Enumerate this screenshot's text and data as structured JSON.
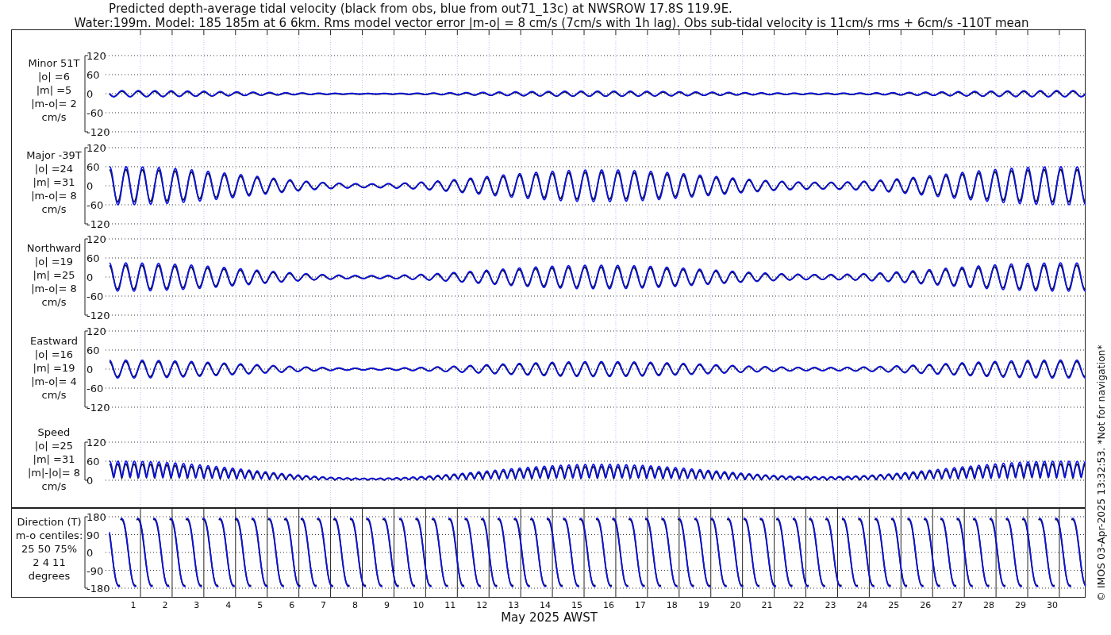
{
  "title_lines": [
    "Predicted depth-average tidal velocity (black from obs, blue from out71_13c) at NWSROW 17.8S 119.9E.",
    "Water:199m. Model: 185 185m at 6 6km. Rms model vector error |m-o| = 8 cm/s (7cm/s with 1h lag). Obs sub-tidal velocity is 11cm/s rms + 6cm/s -110T mean"
  ],
  "panels": [
    {
      "kind": "minor",
      "label_lines": [
        "Minor 51T",
        "|o| =6",
        "|m| =5",
        "|m-o|= 2",
        "cm/s"
      ],
      "yticks": [
        "120",
        "60",
        "0",
        "-60",
        "-120"
      ]
    },
    {
      "kind": "major",
      "label_lines": [
        "Major -39T",
        "|o| =24",
        "|m| =31",
        "|m-o|= 8",
        "cm/s"
      ],
      "yticks": [
        "120",
        "60",
        "0",
        "-60",
        "-120"
      ]
    },
    {
      "kind": "north",
      "label_lines": [
        "Northward",
        "|o| =19",
        "|m| =25",
        "|m-o|= 8",
        "cm/s"
      ],
      "yticks": [
        "120",
        "60",
        "0",
        "-60",
        "-120"
      ]
    },
    {
      "kind": "east",
      "label_lines": [
        "Eastward",
        "|o| =16",
        "|m| =19",
        "|m-o|= 4",
        "cm/s"
      ],
      "yticks": [
        "120",
        "60",
        "0",
        "-60",
        "-120"
      ]
    },
    {
      "kind": "speed",
      "label_lines": [
        "Speed",
        "|o| =25",
        "|m| =31",
        "|m|-|o|= 8",
        "cm/s"
      ],
      "yticks": [
        "120",
        "60",
        "0"
      ]
    },
    {
      "kind": "direction",
      "label_lines": [
        "Direction (T)",
        "m-o centiles:",
        "25 50 75%",
        "2 4 11",
        "degrees"
      ],
      "yticks": [
        "180",
        "90",
        "0",
        "-90",
        "-180"
      ]
    }
  ],
  "xaxis": {
    "day_labels": [
      "1",
      "2",
      "3",
      "4",
      "5",
      "6",
      "7",
      "8",
      "9",
      "10",
      "11",
      "12",
      "13",
      "14",
      "15",
      "16",
      "17",
      "18",
      "19",
      "20",
      "21",
      "22",
      "23",
      "24",
      "25",
      "26",
      "27",
      "28",
      "29",
      "30"
    ],
    "label": "May 2025 AWST"
  },
  "credit": "© IMOS 03-Apr-2025 13:32:53. *Not for navigation*"
}
